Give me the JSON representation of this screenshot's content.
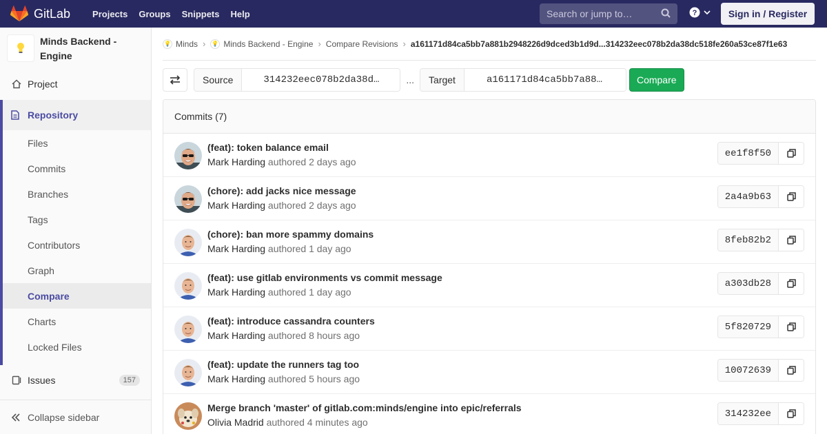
{
  "navbar": {
    "brand": "GitLab",
    "links": [
      "Projects",
      "Groups",
      "Snippets",
      "Help"
    ],
    "search_placeholder": "Search or jump to…",
    "signin": "Sign in / Register"
  },
  "sidebar": {
    "project_name": "Minds Backend - Engine",
    "project_item": "Project",
    "repository": "Repository",
    "repo_items": [
      "Files",
      "Commits",
      "Branches",
      "Tags",
      "Contributors",
      "Graph",
      "Compare",
      "Charts",
      "Locked Files"
    ],
    "active_item": "Compare",
    "issues": "Issues",
    "issues_count": "157",
    "collapse": "Collapse sidebar"
  },
  "breadcrumb": {
    "items": [
      "Minds",
      "Minds Backend - Engine",
      "Compare Revisions"
    ],
    "current": "a161171d84ca5bb7a881b2948226d9dced3b1d9d...314232eec078b2da38dc518fe260a53ce87f1e63"
  },
  "compare": {
    "source_label": "Source",
    "source_value": "314232eec078b2da38d…",
    "separator": "...",
    "target_label": "Target",
    "target_value": "a161171d84ca5bb7a88…",
    "compare_button": "Compare"
  },
  "commits": {
    "header": "Commits (7)",
    "authored_word": "authored",
    "rows": [
      {
        "title": "(feat): token balance email",
        "author": "Mark Harding",
        "time": "2 days ago",
        "sha": "ee1f8f50",
        "avatar": "mark-sunglasses"
      },
      {
        "title": "(chore): add jacks nice message",
        "author": "Mark Harding",
        "time": "2 days ago",
        "sha": "2a4a9b63",
        "avatar": "mark-sunglasses"
      },
      {
        "title": "(chore): ban more spammy domains",
        "author": "Mark Harding",
        "time": "1 day ago",
        "sha": "8feb82b2",
        "avatar": "mark"
      },
      {
        "title": "(feat): use gitlab environments vs commit message",
        "author": "Mark Harding",
        "time": "1 day ago",
        "sha": "a303db28",
        "avatar": "mark"
      },
      {
        "title": "(feat): introduce cassandra counters",
        "author": "Mark Harding",
        "time": "8 hours ago",
        "sha": "5f820729",
        "avatar": "mark"
      },
      {
        "title": "(feat): update the runners tag too",
        "author": "Mark Harding",
        "time": "5 hours ago",
        "sha": "10072639",
        "avatar": "mark"
      },
      {
        "title": "Merge branch 'master' of gitlab.com:minds/engine into epic/referrals",
        "author": "Olivia Madrid",
        "time": "4 minutes ago",
        "sha": "314232ee",
        "avatar": "olivia-dog"
      }
    ]
  },
  "colors": {
    "navbar": "#292961",
    "accent": "#4b4ba3",
    "compare_green": "#1aaa55"
  }
}
